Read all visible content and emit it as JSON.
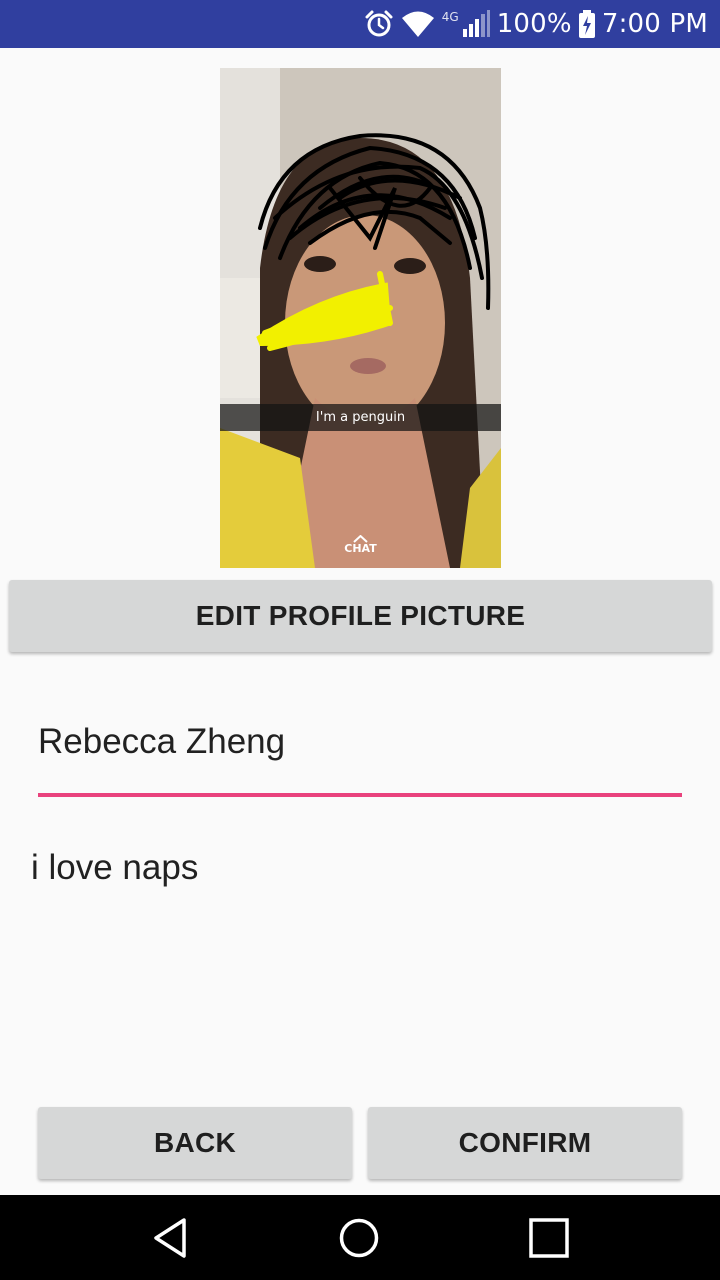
{
  "status_bar": {
    "network_type": "4G",
    "battery_percent": "100%",
    "time": "7:00 PM",
    "icons": [
      "alarm-icon",
      "wifi-icon",
      "cell-signal-icon",
      "battery-charging-icon"
    ],
    "background_color": "#303f9f"
  },
  "profile_photo": {
    "caption": "I'm a penguin",
    "chat_label": "CHAT"
  },
  "buttons": {
    "edit_profile_picture": "EDIT PROFILE PICTURE",
    "back": "BACK",
    "confirm": "CONFIRM"
  },
  "form": {
    "name_value": "Rebecca Zheng",
    "bio_text": "i love naps",
    "accent_color": "#e9427d"
  },
  "nav_bar": {
    "icons": [
      "back-triangle-icon",
      "home-circle-icon",
      "recents-square-icon"
    ]
  }
}
